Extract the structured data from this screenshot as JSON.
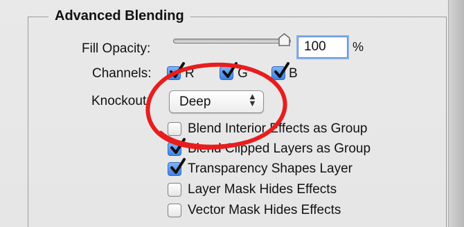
{
  "group": {
    "title": "Advanced Blending"
  },
  "fill_opacity": {
    "label": "Fill Opacity:",
    "value": "100",
    "unit": "%",
    "level_percent": 100
  },
  "channels": {
    "label": "Channels:",
    "items": [
      {
        "label": "R",
        "checked": true
      },
      {
        "label": "G",
        "checked": true
      },
      {
        "label": "B",
        "checked": true
      }
    ]
  },
  "knockout": {
    "label": "Knockout:",
    "selected": "Deep"
  },
  "options": [
    {
      "label": "Blend Interior Effects as Group",
      "checked": false
    },
    {
      "label": "Blend Clipped Layers as Group",
      "checked": true
    },
    {
      "label": "Transparency Shapes Layer",
      "checked": true
    },
    {
      "label": "Layer Mask Hides Effects",
      "checked": false
    },
    {
      "label": "Vector Mask Hides Effects",
      "checked": false
    }
  ],
  "colors": {
    "highlight_ring": "#e81d1d",
    "focus_blue": "#4c84d9",
    "checkbox_blue": "#3f83e7"
  }
}
